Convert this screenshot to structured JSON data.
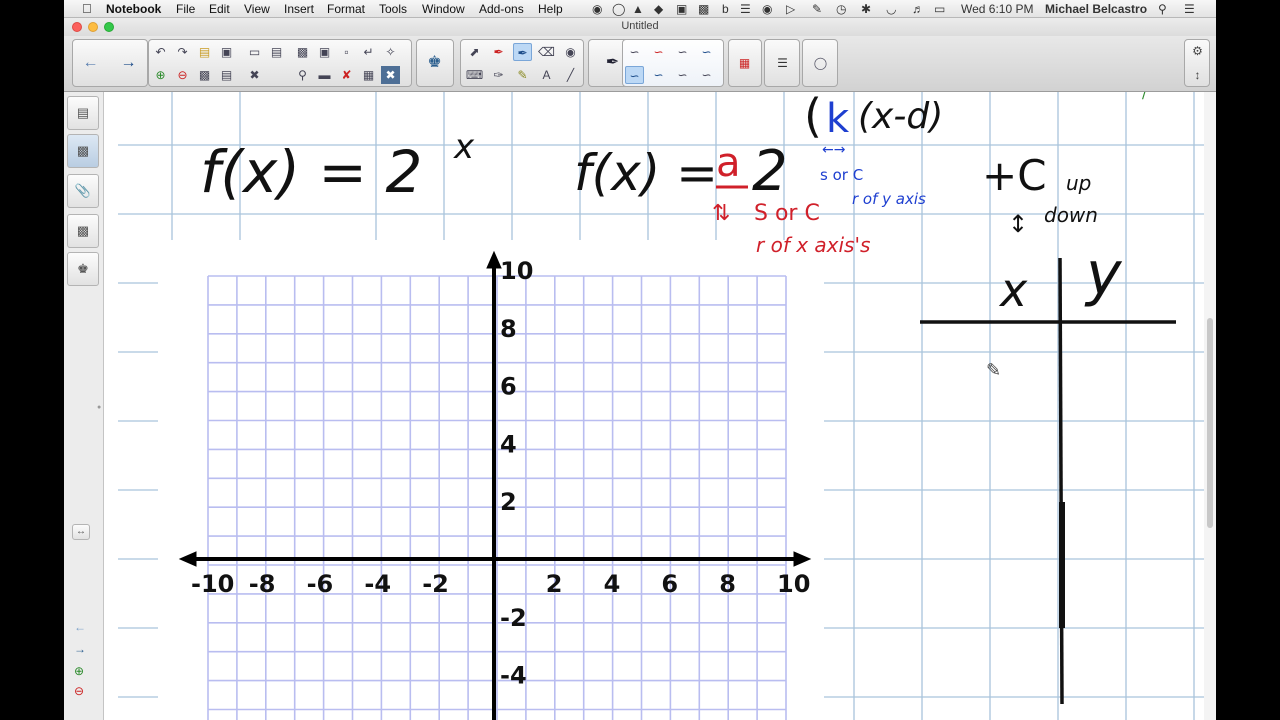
{
  "menubar": {
    "app_name": "Notebook",
    "menus": [
      "File",
      "Edit",
      "View",
      "Insert",
      "Format",
      "Tools",
      "Window",
      "Add-ons",
      "Help"
    ],
    "clock": "Wed 6:10 PM",
    "user": "Michael Belcastro"
  },
  "window": {
    "title": "Untitled"
  },
  "toolbar": {
    "icons": [
      "back-arrow",
      "forward-arrow",
      "undo",
      "redo",
      "open",
      "paste",
      "screen-shade",
      "document-camera",
      "capture",
      "insert-table",
      "delete",
      "full-screen",
      "add-ons",
      "select",
      "pen",
      "creative-pen",
      "eraser",
      "line",
      "shape",
      "text",
      "fill",
      "line-style",
      "properties"
    ]
  },
  "side_tabs": [
    "page-sorter",
    "gallery",
    "attachments",
    "properties",
    "add-ons"
  ],
  "handwriting": {
    "eq1": "f(x) = 2",
    "eq1_exp": "x",
    "eq2_left": "f(x) =",
    "eq2_a": "a",
    "eq2_base": "2",
    "eq2_k": "k",
    "eq2_xd": "(x-d)",
    "eq2_d": "d",
    "k_note": "s or C",
    "k_note2": "r of y axis",
    "a_note": "S or C",
    "a_note2": "r of x axis's",
    "c_term": "+C",
    "c_up": "up",
    "c_down": "down",
    "table_x": "x",
    "table_y": "y"
  },
  "graph": {
    "x_ticks": [
      "-10",
      "-8",
      "-6",
      "-4",
      "-2",
      "2",
      "4",
      "6",
      "8",
      "10"
    ],
    "y_ticks": [
      "10",
      "8",
      "6",
      "4",
      "2",
      "-2",
      "-4"
    ]
  },
  "colors": {
    "ink_black": "#111111",
    "ink_red": "#d0202a",
    "ink_blue": "#1e3fd0",
    "ink_green": "#2c8a2c",
    "grid_blue": "#b9bdf0",
    "page_grid": "#a9c4dc"
  }
}
